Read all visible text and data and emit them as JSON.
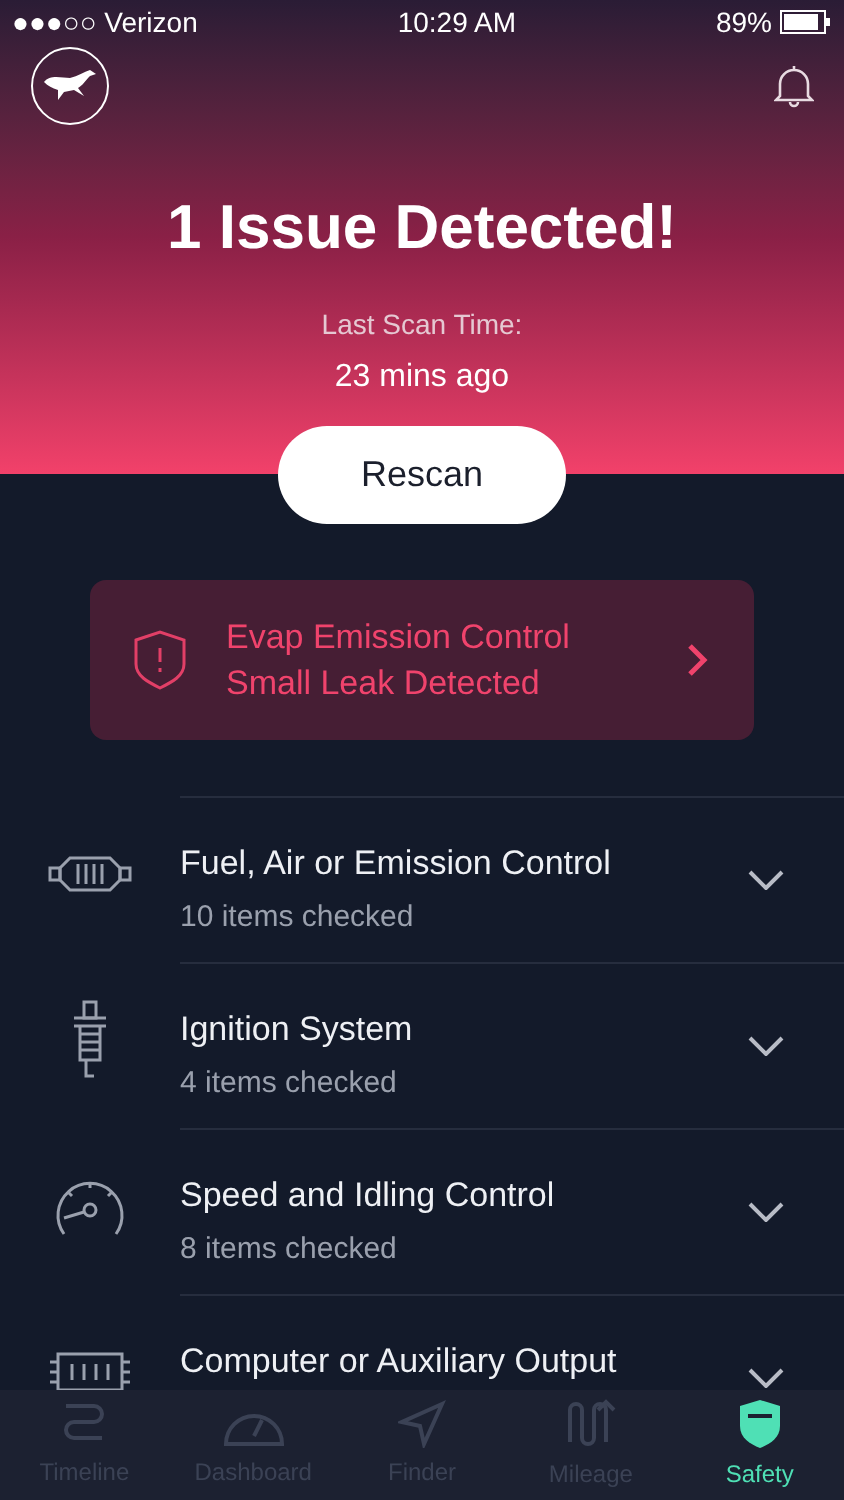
{
  "status_bar": {
    "carrier": "●●●○○ Verizon",
    "time": "10:29 AM",
    "battery": "89%"
  },
  "header": {
    "title": "1 Issue Detected!",
    "scan_label": "Last Scan Time:",
    "scan_value": "23 mins ago"
  },
  "rescan_button": "Rescan",
  "alert": {
    "line1": "Evap Emission Control",
    "line2": "Small Leak Detected"
  },
  "categories": [
    {
      "kind": "filter",
      "title": "Fuel, Air or Emission Control",
      "subtitle": "10 items checked",
      "expanded": false
    },
    {
      "kind": "plug",
      "title": "Ignition System",
      "subtitle": "4 items checked",
      "expanded": false
    },
    {
      "kind": "gauge",
      "title": "Speed and Idling Control",
      "subtitle": "8 items checked",
      "expanded": false
    },
    {
      "kind": "ecu",
      "title": "Computer or Auxiliary Output",
      "expanded": false
    }
  ],
  "tabs": [
    {
      "kind": "timeline",
      "label": "Timeline",
      "selected": false
    },
    {
      "kind": "dashboard",
      "label": "Dashboard",
      "selected": false
    },
    {
      "kind": "finder",
      "label": "Finder",
      "selected": false
    },
    {
      "kind": "mileage",
      "label": "Mileage",
      "selected": false
    },
    {
      "kind": "safety",
      "label": "Safety",
      "selected": true
    }
  ]
}
